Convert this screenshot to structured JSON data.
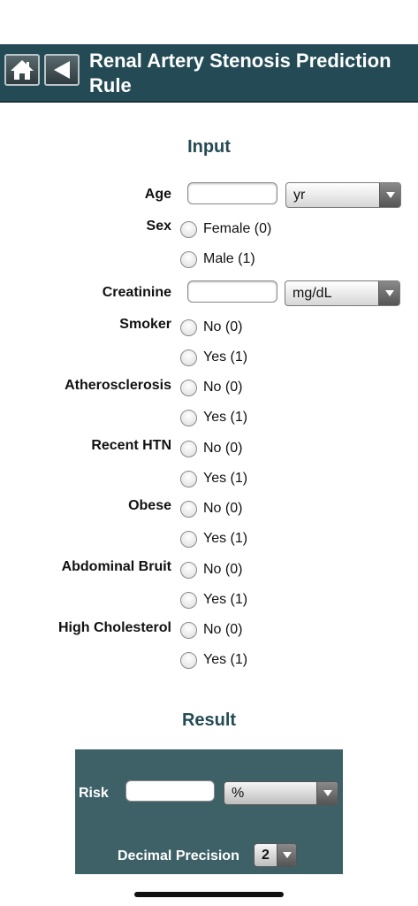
{
  "header": {
    "home_icon": "home-icon",
    "back_icon": "back-arrow-icon",
    "title": "Renal Artery Stenosis Prediction Rule",
    "background": "#244b55"
  },
  "input": {
    "title": "Input",
    "age": {
      "label": "Age",
      "value": "",
      "unit": "yr"
    },
    "sex": {
      "label": "Sex",
      "options": [
        "Female (0)",
        "Male (1)"
      ]
    },
    "creatinine": {
      "label": "Creatinine",
      "value": "",
      "unit": "mg/dL"
    },
    "smoker": {
      "label": "Smoker",
      "options": [
        "No (0)",
        "Yes (1)"
      ]
    },
    "atherosclerosis": {
      "label": "Atherosclerosis",
      "options": [
        "No (0)",
        "Yes (1)"
      ]
    },
    "recent_htn": {
      "label": "Recent HTN",
      "options": [
        "No (0)",
        "Yes (1)"
      ]
    },
    "obese": {
      "label": "Obese",
      "options": [
        "No (0)",
        "Yes (1)"
      ]
    },
    "abdominal_bruit": {
      "label": "Abdominal Bruit",
      "options": [
        "No (0)",
        "Yes (1)"
      ]
    },
    "high_cholesterol": {
      "label": "High Cholesterol",
      "options": [
        "No (0)",
        "Yes (1)"
      ]
    }
  },
  "result": {
    "title": "Result",
    "risk_label": "Risk",
    "risk_value": "",
    "risk_unit": "%",
    "precision_label": "Decimal Precision",
    "precision_value": "2",
    "background": "#3e6168"
  }
}
